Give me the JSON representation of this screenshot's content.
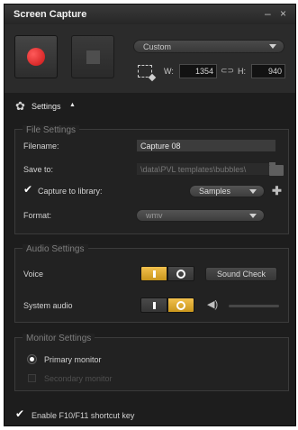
{
  "window": {
    "title": "Screen Capture",
    "minimize_glyph": "–",
    "close_glyph": "×"
  },
  "capture": {
    "record_icon": "record-icon",
    "stop_icon": "stop-icon",
    "preset": "Custom",
    "width_label": "W:",
    "width": "1354",
    "height_label": "H:",
    "height": "940",
    "lock_glyph": "⊂⊃"
  },
  "settings": {
    "label": "Settings",
    "caret": "▲"
  },
  "file_settings": {
    "title": "File Settings",
    "filename_label": "Filename:",
    "filename": "Capture 08",
    "save_to_label": "Save to:",
    "save_to": "\\data\\PVL templates\\bubbles\\",
    "capture_to_library_label": "Capture to library:",
    "library": "Samples",
    "format_label": "Format:",
    "format": "wmv"
  },
  "audio_settings": {
    "title": "Audio Settings",
    "voice_label": "Voice",
    "sound_check": "Sound Check",
    "system_audio_label": "System audio"
  },
  "monitor_settings": {
    "title": "Monitor Settings",
    "primary": "Primary monitor",
    "secondary": "Secondary monitor"
  },
  "footer": {
    "shortcut_label": "Enable F10/F11 shortcut key"
  },
  "colors": {
    "accent": "#e2ab2f",
    "record": "#d31b1b",
    "background": "#1d1d1d"
  }
}
